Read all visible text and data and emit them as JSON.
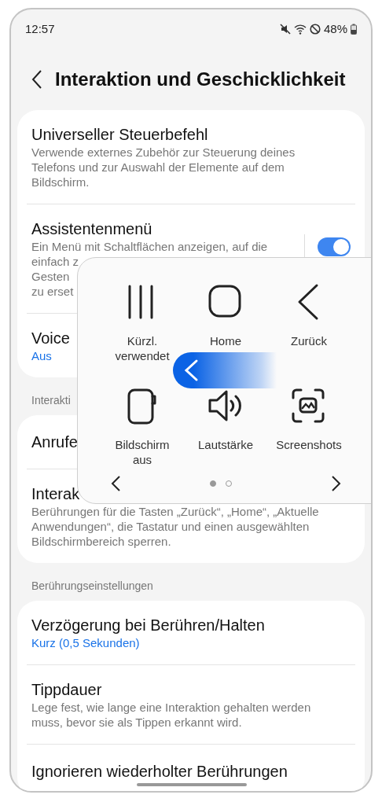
{
  "status_bar": {
    "time": "12:57",
    "battery": "48%"
  },
  "header": {
    "title": "Interaktion und Geschicklichkeit"
  },
  "sections": [
    {
      "items": [
        {
          "kind": "description",
          "title": "Universeller Steuerbefehl",
          "subtitle": "Verwende externes Zubehör zur Steuerung deines Telefons und zur Auswahl der Elemente auf dem Bildschirm."
        },
        {
          "kind": "toggle",
          "title": "Assistentenmenü",
          "subtitle_lines": [
            "Ein Menü mit Schaltflächen anzeigen, auf die",
            "einfach z",
            "Gesten",
            "zu erset"
          ],
          "on": true
        },
        {
          "kind": "value",
          "title": "Voice",
          "subtitle": "Aus"
        }
      ]
    },
    {
      "header": "Interakti",
      "items": [
        {
          "kind": "plain",
          "title": "Anrufe"
        },
        {
          "kind": "description",
          "title": "Interak",
          "subtitle": "Berührungen für die Tasten „Zurück“, „Home“, „Aktuelle Anwendungen“, die Tastatur und einen ausgewählten Bildschirmbereich sperren."
        }
      ]
    },
    {
      "header": "Berührungseinstellungen",
      "items": [
        {
          "kind": "value",
          "title": "Verzögerung bei Berühren/Halten",
          "subtitle": "Kurz (0,5 Sekunden)"
        },
        {
          "kind": "description",
          "title": "Tippdauer",
          "subtitle": "Lege fest, wie lange eine Interaktion gehalten werden muss, bevor sie als Tippen erkannt wird."
        },
        {
          "kind": "plain",
          "title": "Ignorieren wiederholter Berührungen"
        }
      ]
    }
  ],
  "assistant_menu": {
    "buttons": [
      {
        "kind": "recents",
        "label": "Kürzl. verwendet"
      },
      {
        "kind": "home",
        "label": "Home"
      },
      {
        "kind": "back",
        "label": "Zurück"
      },
      {
        "kind": "screen_off",
        "label": "Bildschirm aus"
      },
      {
        "kind": "volume",
        "label": "Lautstärke"
      },
      {
        "kind": "screenshot",
        "label": "Screenshots"
      }
    ],
    "pages": [
      {
        "selected": true
      },
      {
        "selected": false
      }
    ]
  }
}
